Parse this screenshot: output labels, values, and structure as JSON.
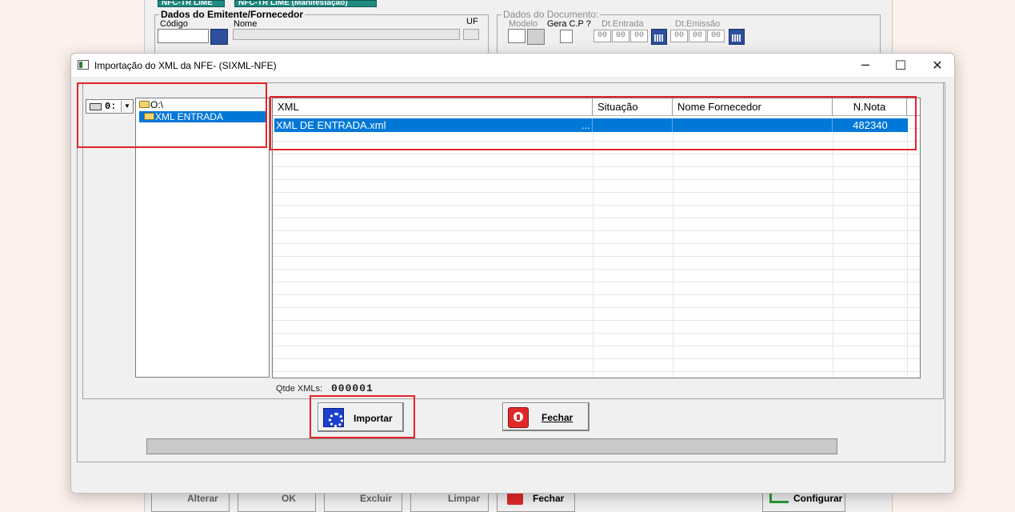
{
  "background_form": {
    "tab1_label": "NFC-TR LIME",
    "tab2_label": "NFC-TR LIME (Manifestação)",
    "emitente_group_title": "Dados do Emitente/Fornecedor",
    "codigo_label": "Código",
    "nome_label": "Nome",
    "uf_label": "UF",
    "documento_group_title": "Dados do Documento:",
    "modelo_label": "Modelo",
    "gera_cp_label": "Gera C.P ?",
    "dt_entrada_label": "Dt.Entrada",
    "dt_emissao_label": "Dt.Emissão",
    "date_segment": "00",
    "bottom_buttons": {
      "alterar": "Alterar",
      "ok": "OK",
      "excluir": "Excluir",
      "limpar": "Limpar",
      "fechar": "Fechar",
      "configurar": "Configurar"
    }
  },
  "dialog": {
    "title": "Importação do XML da NFE- (SIXML-NFE)",
    "controls": {
      "minimize": "─",
      "maximize": "☐",
      "close": "✕"
    },
    "drive_selector": {
      "value": "0:"
    },
    "folder_tree": [
      {
        "label": "O:\\"
      },
      {
        "label": "XML ENTRADA",
        "selected": true
      }
    ],
    "grid": {
      "columns": [
        "XML",
        "Situação",
        "Nome Fornecedor",
        "N.Nota"
      ],
      "rows": [
        {
          "xml": "XML DE ENTRADA.xml",
          "ellipsis": "...",
          "situacao": "",
          "nome_fornecedor": "",
          "n_nota": "482340",
          "selected": true
        }
      ]
    },
    "qtde_label": "Qtde XMLs:",
    "qtde_value": "000001",
    "importar_label": "Importar",
    "fechar_label": "Fechar",
    "progress": 0,
    "colors": {
      "selection": "#0078d7",
      "highlight": "#e2232a"
    }
  }
}
